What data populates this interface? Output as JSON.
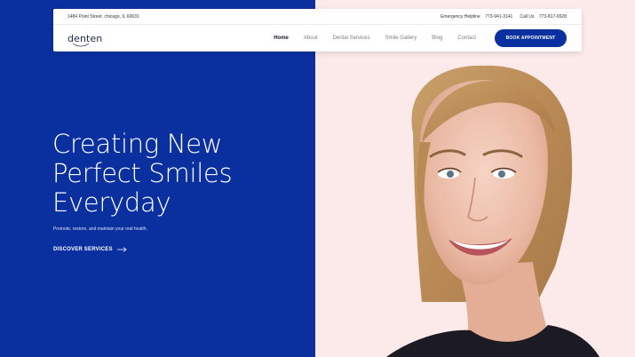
{
  "topbar": {
    "address": "1484 Point Street, chicago, IL 60631",
    "helpline_label": "Emergency Helpline",
    "helpline_number": "773-941-3141",
    "call_label": "Call Us",
    "call_number": "773-817-6528"
  },
  "nav": {
    "logo": "denten",
    "items": [
      "Home",
      "About",
      "Dental Services",
      "Smile Gallery",
      "Blog",
      "Contact"
    ],
    "active": "Home",
    "cta": "BOOK APPOINTMENT"
  },
  "hero": {
    "title_lines": [
      "Creating New",
      "Perfect Smiles",
      "Everyday"
    ],
    "subtitle": "Promote, restore, and maintain your oral health.",
    "link": "DISCOVER SERVICES"
  },
  "colors": {
    "brand_blue": "#0a30a0",
    "pink_bg": "#fce9ea"
  },
  "icons": [
    "smile-logo-icon",
    "arrow-right-icon"
  ]
}
